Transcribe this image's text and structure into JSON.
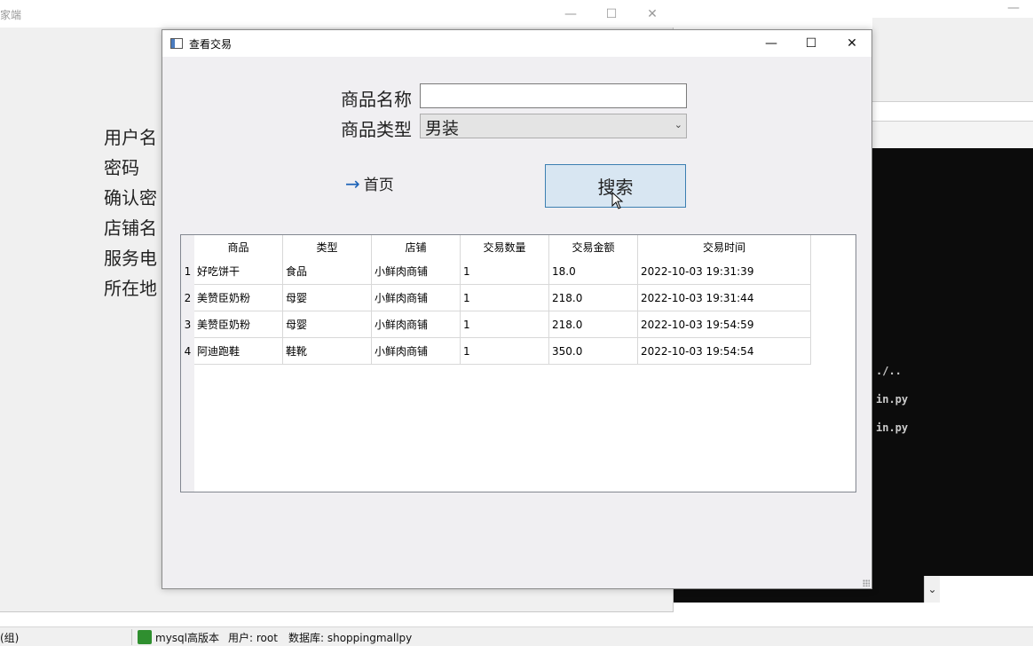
{
  "background_window": {
    "title": "家端",
    "labels": [
      "用户名",
      "密码",
      "确认密",
      "店铺名",
      "服务电",
      "所在地"
    ]
  },
  "terminal": {
    "lines": [
      "./..",
      "in.py",
      "in.py"
    ]
  },
  "statusbar": {
    "left_text": "(组)",
    "mysql_label": "mysql高版本",
    "user_text": "用户: root",
    "db_text": "数据库: shoppingmallpy"
  },
  "dialog": {
    "title": "查看交易",
    "name_label": "商品名称",
    "name_value": "",
    "type_label": "商品类型",
    "type_value": "男装",
    "home_link": "首页",
    "search_button": "搜索",
    "table": {
      "columns": [
        "商品",
        "类型",
        "店铺",
        "交易数量",
        "交易金额",
        "交易时间"
      ],
      "rows": [
        {
          "num": "1",
          "cells": [
            "好吃饼干",
            "食品",
            "小鲜肉商铺",
            "1",
            "18.0",
            "2022-10-03 19:31:39"
          ]
        },
        {
          "num": "2",
          "cells": [
            "美赞臣奶粉",
            "母婴",
            "小鲜肉商铺",
            "1",
            "218.0",
            "2022-10-03 19:31:44"
          ]
        },
        {
          "num": "3",
          "cells": [
            "美赞臣奶粉",
            "母婴",
            "小鲜肉商铺",
            "1",
            "218.0",
            "2022-10-03 19:54:59"
          ]
        },
        {
          "num": "4",
          "cells": [
            "阿迪跑鞋",
            "鞋靴",
            "小鲜肉商铺",
            "1",
            "350.0",
            "2022-10-03 19:54:54"
          ]
        }
      ]
    }
  },
  "colors": {
    "accent": "#1e63b8",
    "button_border": "#3c7fb1",
    "button_bg": "#d8e6f2"
  }
}
